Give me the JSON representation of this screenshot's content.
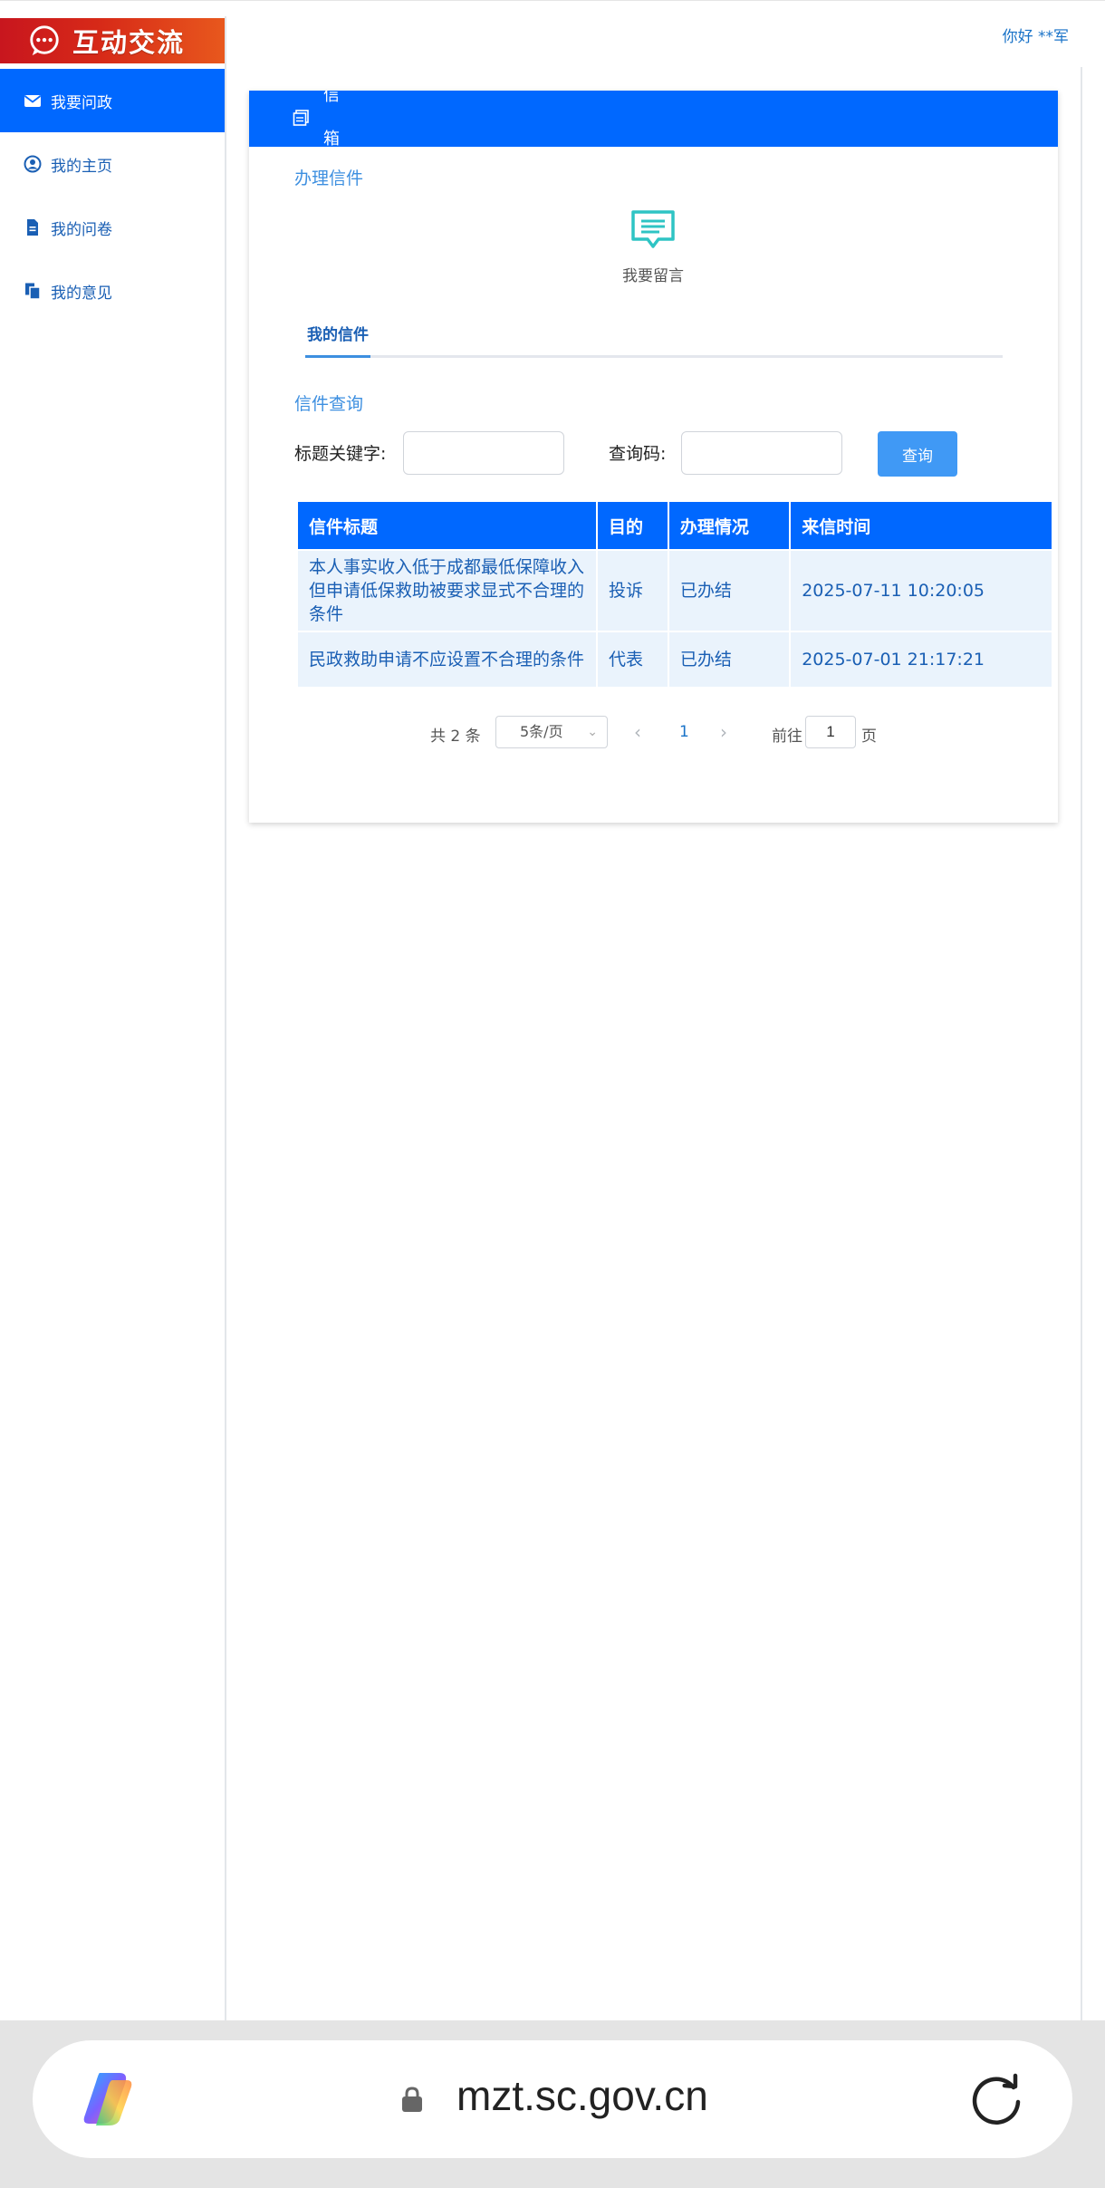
{
  "brand": {
    "title": "互动交流"
  },
  "greeting": "你好 **军",
  "sidebar": {
    "items": [
      {
        "label": "我要问政",
        "icon": "envelope-icon",
        "active": true
      },
      {
        "label": "我的主页",
        "icon": "user-circle-icon",
        "active": false
      },
      {
        "label": "我的问卷",
        "icon": "document-icon",
        "active": false
      },
      {
        "label": "我的意见",
        "icon": "copy-icon",
        "active": false
      }
    ]
  },
  "card": {
    "header_title": "信箱",
    "handle_label": "办理信件",
    "leave_message_label": "我要留言",
    "tabs": [
      {
        "label": "我的信件"
      }
    ],
    "query_section_label": "信件查询",
    "keyword_label": "标题关键字:",
    "keyword_value": "",
    "code_label": "查询码:",
    "code_value": "",
    "query_button": "查询"
  },
  "table": {
    "columns": [
      "信件标题",
      "目的",
      "办理情况",
      "来信时间"
    ],
    "rows": [
      {
        "title": "本人事实收入低于成都最低保障收入但申请低保救助被要求显式不合理的条件",
        "purpose": "投诉",
        "status": "已办结",
        "time": "2025-07-11 10:20:05"
      },
      {
        "title": "民政救助申请不应设置不合理的条件",
        "purpose": "代表",
        "status": "已办结",
        "time": "2025-07-01 21:17:21"
      }
    ]
  },
  "pagination": {
    "total": "共 2 条",
    "page_size": "5条/页",
    "current_page": "1",
    "goto_label": "前往",
    "goto_value": "1",
    "page_unit": "页"
  },
  "browser": {
    "url": "mzt.sc.gov.cn"
  },
  "colors": {
    "primary": "#0068ff",
    "link": "#1a5fb4",
    "brand_red": "#c8161e",
    "brand_orange": "#e8581d",
    "row_bg": "#eaf3fc",
    "teal_icon": "#2ec4c4"
  }
}
